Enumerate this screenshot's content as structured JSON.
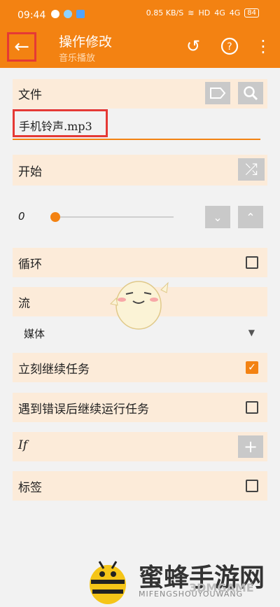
{
  "status_bar": {
    "time": "09:44",
    "net_speed": "0.85 KB/S",
    "hd": "HD",
    "sig1": "4G",
    "sig2": "4G",
    "battery": "84"
  },
  "app_bar": {
    "title": "操作修改",
    "subtitle": "音乐播放"
  },
  "file_row": {
    "label": "文件"
  },
  "file_input": {
    "value": "手机铃声.mp3"
  },
  "start_row": {
    "label": "开始"
  },
  "slider": {
    "value_label": "0",
    "position": 0
  },
  "loop_row": {
    "label": "循环",
    "checked": false
  },
  "stream_row": {
    "label": "流"
  },
  "stream_select": {
    "value": "媒体"
  },
  "continue_row": {
    "label": "立刻继续任务",
    "checked": true
  },
  "error_row": {
    "label": "遇到错误后继续运行任务",
    "checked": false
  },
  "if_row": {
    "label": "If"
  },
  "tag_row": {
    "label": "标签",
    "checked": false
  },
  "watermark": {
    "title": "蜜蜂手游网",
    "sub": "MIFENGSHOUYOUWANG",
    "overlay": "3DMGAME"
  },
  "colors": {
    "accent": "#f38212",
    "highlight": "#e53935",
    "card": "#fcebd9"
  }
}
